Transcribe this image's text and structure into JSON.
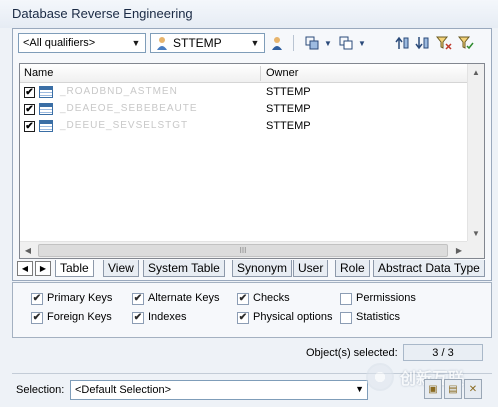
{
  "window": {
    "title": "Database Reverse Engineering"
  },
  "toolbar": {
    "qualifier_value": "<All qualifiers>",
    "owner_value": "STTEMP",
    "icons": [
      "select-user-icon",
      "select-all-icon",
      "deselect-all-icon",
      "move-up-icon",
      "move-down-icon",
      "filter-icon",
      "sort-icon"
    ]
  },
  "list": {
    "columns": [
      "Name",
      "Owner"
    ],
    "rows": [
      {
        "name": "_ROADBND_ASTMEN",
        "owner": "STTEMP",
        "checked": "✔"
      },
      {
        "name": "_DEAEOE_SEBEBEAUTE",
        "owner": "STTEMP",
        "checked": "✔"
      },
      {
        "name": "_DEEUE_SEVSELSTGT",
        "owner": "STTEMP",
        "checked": "✔"
      }
    ],
    "scroll_grip": "III"
  },
  "tabs": [
    "Table",
    "View",
    "System Table",
    "Synonym",
    "User",
    "Role",
    "Abstract Data Type"
  ],
  "options": {
    "primary_keys": {
      "label": "Primary Keys",
      "checked": "✔"
    },
    "alternate_keys": {
      "label": "Alternate Keys",
      "checked": "✔"
    },
    "checks": {
      "label": "Checks",
      "checked": "✔"
    },
    "permissions": {
      "label": "Permissions",
      "checked": ""
    },
    "foreign_keys": {
      "label": "Foreign Keys",
      "checked": "✔"
    },
    "indexes": {
      "label": "Indexes",
      "checked": "✔"
    },
    "physical_options": {
      "label": "Physical options",
      "checked": "✔"
    },
    "statistics": {
      "label": "Statistics",
      "checked": ""
    }
  },
  "status": {
    "label": "Object(s) selected:",
    "value": "3 / 3"
  },
  "selection": {
    "label": "Selection:",
    "value": "<Default Selection>"
  },
  "watermark": {
    "text": "创新互联"
  }
}
